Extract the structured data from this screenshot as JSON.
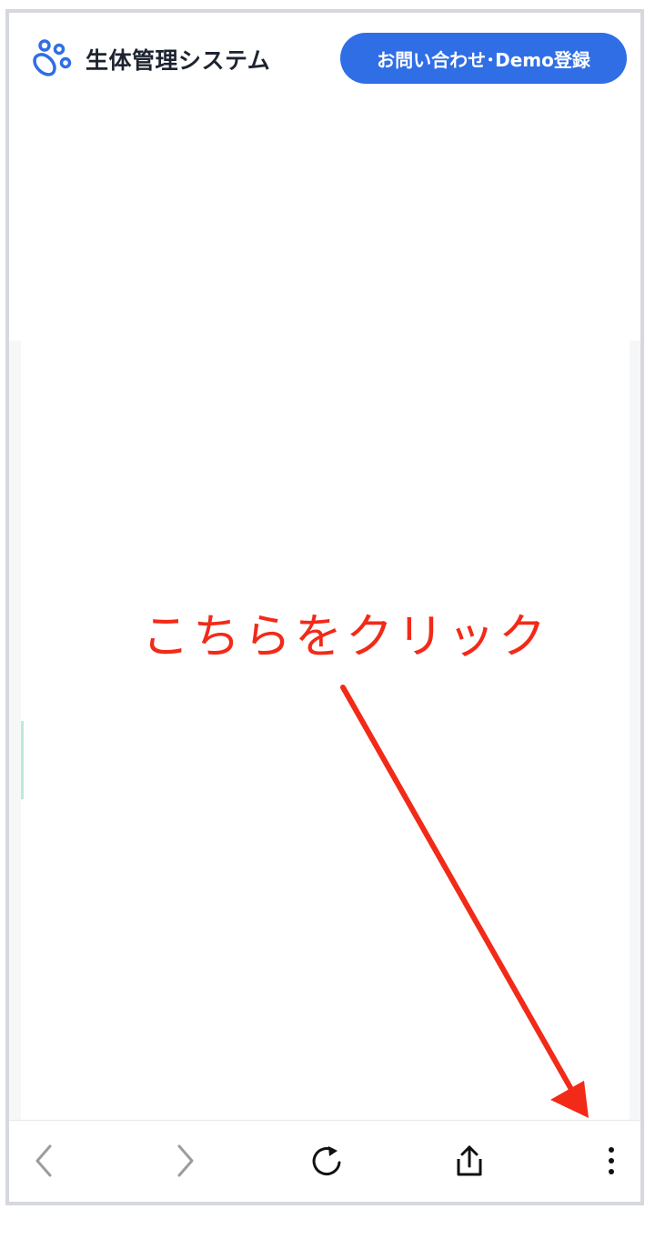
{
  "header": {
    "brand_name": "生体管理システム",
    "logo_icon": "paw-icon",
    "cta_label": "お問い合わせ･Demo登録",
    "brand_color": "#2f6ee5"
  },
  "annotation": {
    "instruction": "こちらをクリック",
    "color": "#f22a18"
  },
  "toolbar": {
    "buttons": [
      {
        "icon": "back-chevron-icon",
        "enabled": false
      },
      {
        "icon": "forward-chevron-icon",
        "enabled": false
      },
      {
        "icon": "reload-icon",
        "enabled": true
      },
      {
        "icon": "share-icon",
        "enabled": true
      },
      {
        "icon": "more-menu-icon",
        "enabled": true
      }
    ]
  }
}
